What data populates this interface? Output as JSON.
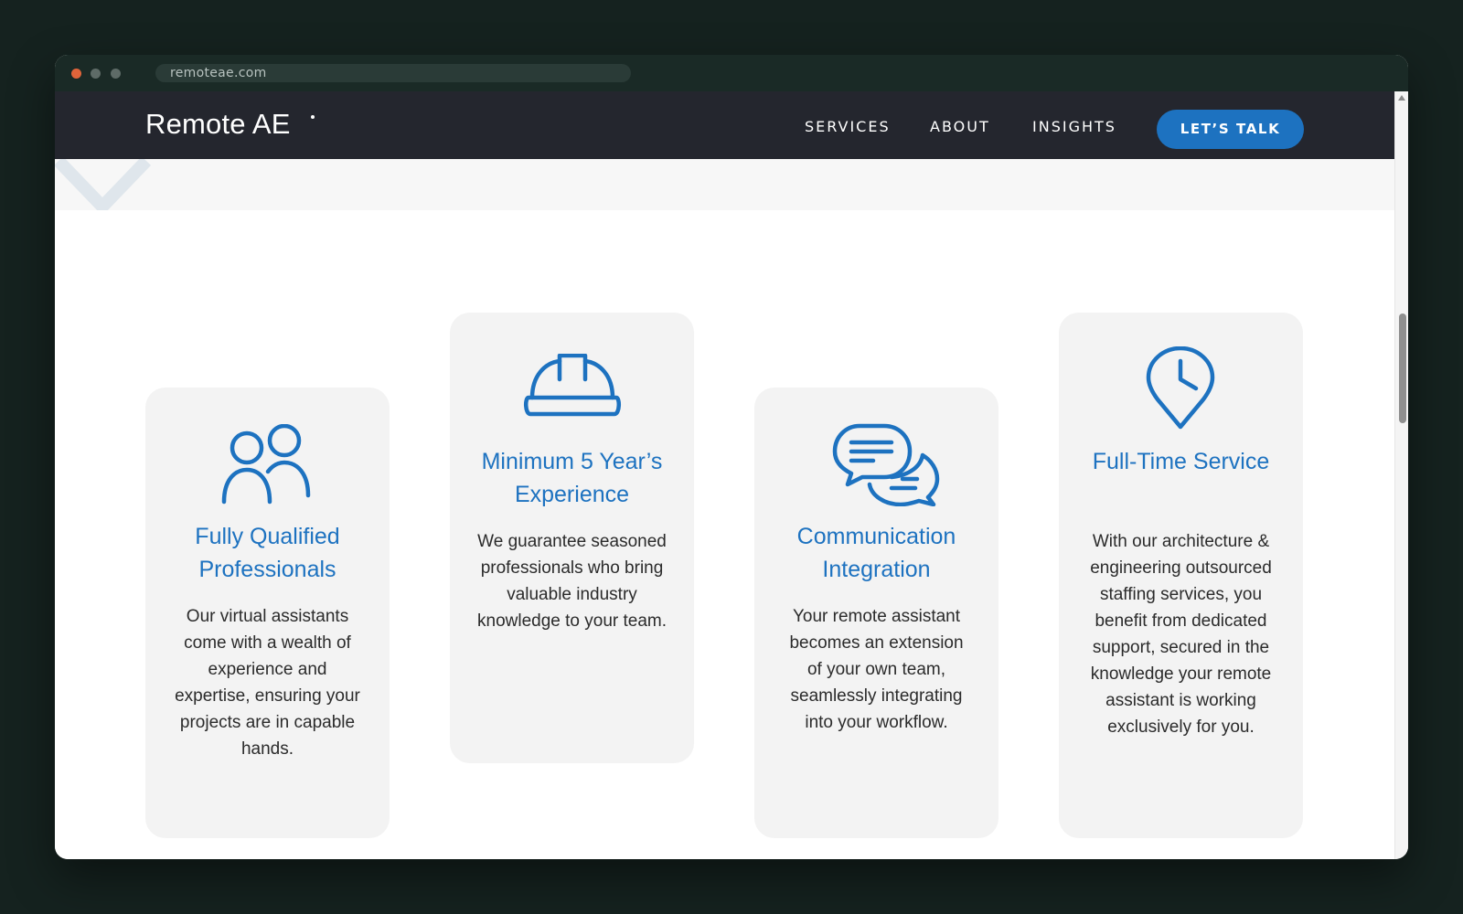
{
  "browser": {
    "url": "remoteae.com"
  },
  "nav": {
    "logo": "Remote AE",
    "items": [
      "SERVICES",
      "ABOUT",
      "INSIGHTS"
    ],
    "cta": "LET’S TALK"
  },
  "colors": {
    "accent": "#1d72c0",
    "navbar_bg": "#24262e",
    "card_bg": "#f3f3f3",
    "page_bg": "#15221f"
  },
  "features": [
    {
      "icon": "people-icon",
      "title": "Fully Qualified Professionals",
      "text": "Our virtual assistants come with a wealth of experience and expertise, ensuring your projects are in capable hands."
    },
    {
      "icon": "hard-hat-icon",
      "title": "Minimum 5 Year’s Experience",
      "text": "We guarantee seasoned professionals who bring valuable industry knowledge to your team."
    },
    {
      "icon": "chat-bubbles-icon",
      "title": "Communication Integration",
      "text": "Your remote assistant becomes an extension of your own team, seamlessly integrating into your workflow."
    },
    {
      "icon": "clock-pin-icon",
      "title": "Full-Time Service",
      "text": "With our architecture & engineering outsourced staffing services, you benefit from dedicated support, secured in the knowledge your remote assistant is working exclusively for you."
    }
  ]
}
